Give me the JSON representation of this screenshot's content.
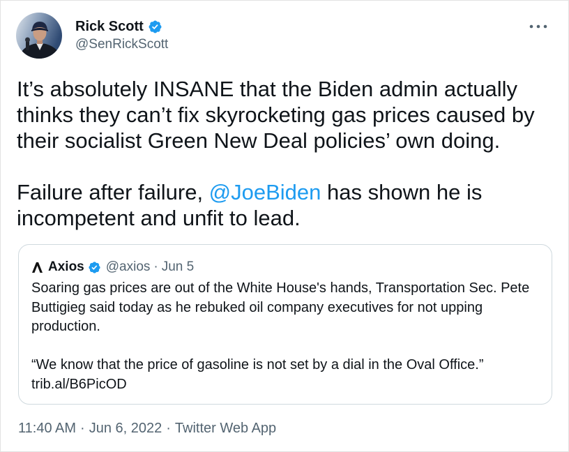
{
  "author": {
    "name": "Rick Scott",
    "handle": "@SenRickScott",
    "verified": true
  },
  "tweet": {
    "paragraph_1": [
      "It’s absolutely INSANE that the Biden admin actually",
      "thinks they can’t fix skyrocketing gas prices caused by",
      "their socialist Green New Deal policies’ own doing."
    ],
    "paragraph_2": {
      "line_1_before_mention": "Failure after failure, ",
      "mention": "@JoeBiden",
      "line_1_after_mention": " has shown he is",
      "line_2": "incompetent and unfit to lead."
    }
  },
  "quoted_tweet": {
    "author": {
      "name": "Axios",
      "handle": "@axios",
      "verified": true
    },
    "separator": "·",
    "date": "Jun 5",
    "text_lines": [
      "Soaring gas prices are out of the White House's hands, Transportation Sec. Pete",
      "Buttigieg said today as he rebuked oil company executives for not upping",
      "production."
    ],
    "quote_line": "“We know that the price of gasoline is not set by a dial in the Oval Office.”",
    "link": "trib.al/B6PicOD"
  },
  "meta": {
    "time": "11:40 AM",
    "separator": "·",
    "date": "Jun 6, 2022",
    "source": "Twitter Web App"
  },
  "icons": {
    "avatar": "profile-photo",
    "verified": "verified-badge-icon",
    "more": "more-horizontal-icon",
    "quoted_logo": "axios-logo-icon"
  },
  "colors": {
    "text": "#0f1419",
    "secondary_text": "#536471",
    "accent": "#1d9bf0",
    "card_border": "#cfd9de",
    "background": "#ffffff"
  }
}
